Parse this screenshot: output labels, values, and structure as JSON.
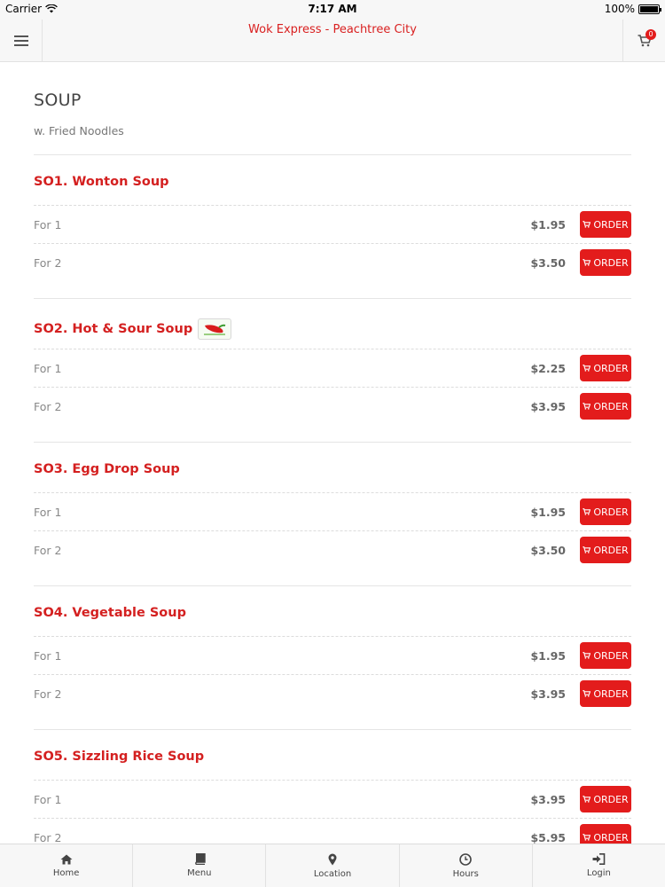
{
  "status_bar": {
    "carrier": "Carrier",
    "time": "7:17 AM",
    "battery": "100%"
  },
  "header": {
    "title": "Wok Express - Peachtree City",
    "cart_count": "0"
  },
  "section": {
    "title": "SOUP",
    "subtitle": "w. Fried Noodles"
  },
  "items": [
    {
      "name": "SO1. Wonton Soup",
      "spicy": false,
      "options": [
        {
          "size": "For 1",
          "price": "$1.95"
        },
        {
          "size": "For 2",
          "price": "$3.50"
        }
      ]
    },
    {
      "name": "SO2. Hot & Sour Soup",
      "spicy": true,
      "options": [
        {
          "size": "For 1",
          "price": "$2.25"
        },
        {
          "size": "For 2",
          "price": "$3.95"
        }
      ]
    },
    {
      "name": "SO3. Egg Drop Soup",
      "spicy": false,
      "options": [
        {
          "size": "For 1",
          "price": "$1.95"
        },
        {
          "size": "For 2",
          "price": "$3.50"
        }
      ]
    },
    {
      "name": "SO4. Vegetable Soup",
      "spicy": false,
      "options": [
        {
          "size": "For 1",
          "price": "$1.95"
        },
        {
          "size": "For 2",
          "price": "$3.95"
        }
      ]
    },
    {
      "name": "SO5. Sizzling Rice Soup",
      "spicy": false,
      "options": [
        {
          "size": "For 1",
          "price": "$3.95"
        },
        {
          "size": "For 2",
          "price": "$5.95"
        }
      ]
    }
  ],
  "order_label": "ORDER",
  "tabs": [
    {
      "label": "Home",
      "icon": "home-icon"
    },
    {
      "label": "Menu",
      "icon": "book-icon"
    },
    {
      "label": "Location",
      "icon": "map-pin-icon"
    },
    {
      "label": "Hours",
      "icon": "clock-icon"
    },
    {
      "label": "Login",
      "icon": "login-icon"
    }
  ],
  "colors": {
    "accent": "#e31c1c",
    "title_red": "#d42020"
  }
}
